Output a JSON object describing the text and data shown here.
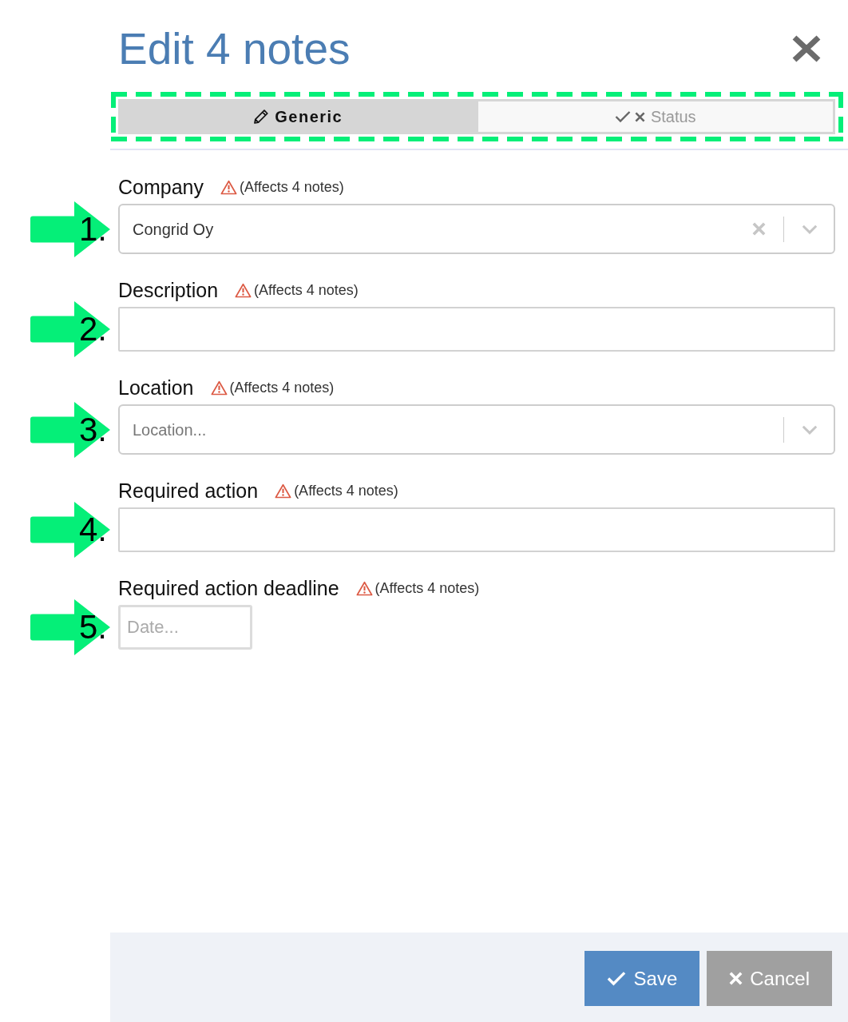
{
  "dialog": {
    "title": "Edit 4 notes"
  },
  "tab_bar": {
    "highlighted": true,
    "tabs": [
      {
        "label": "Generic",
        "selected": true
      },
      {
        "label": "Status",
        "selected": false
      }
    ]
  },
  "fields": [
    {
      "kind": "select",
      "label": "Company",
      "warning": "(Affects 4 notes)",
      "value": "Congrid Oy",
      "clearable": true,
      "marker": "1."
    },
    {
      "kind": "text",
      "label": "Description",
      "warning": "(Affects 4 notes)",
      "marker": "2."
    },
    {
      "kind": "select",
      "label": "Location",
      "warning": "(Affects 4 notes)",
      "placeholder": "Location...",
      "clearable": false,
      "marker": "3."
    },
    {
      "kind": "text",
      "label": "Required action",
      "warning": "(Affects 4 notes)",
      "marker": "4."
    },
    {
      "kind": "date",
      "label": "Required action deadline",
      "warning": "(Affects 4 notes)",
      "placeholder": "Date...",
      "marker": "5."
    }
  ],
  "footer": {
    "buttons": [
      {
        "label": "Save",
        "kind": "primary"
      },
      {
        "label": "Cancel",
        "kind": "secondary"
      }
    ]
  }
}
